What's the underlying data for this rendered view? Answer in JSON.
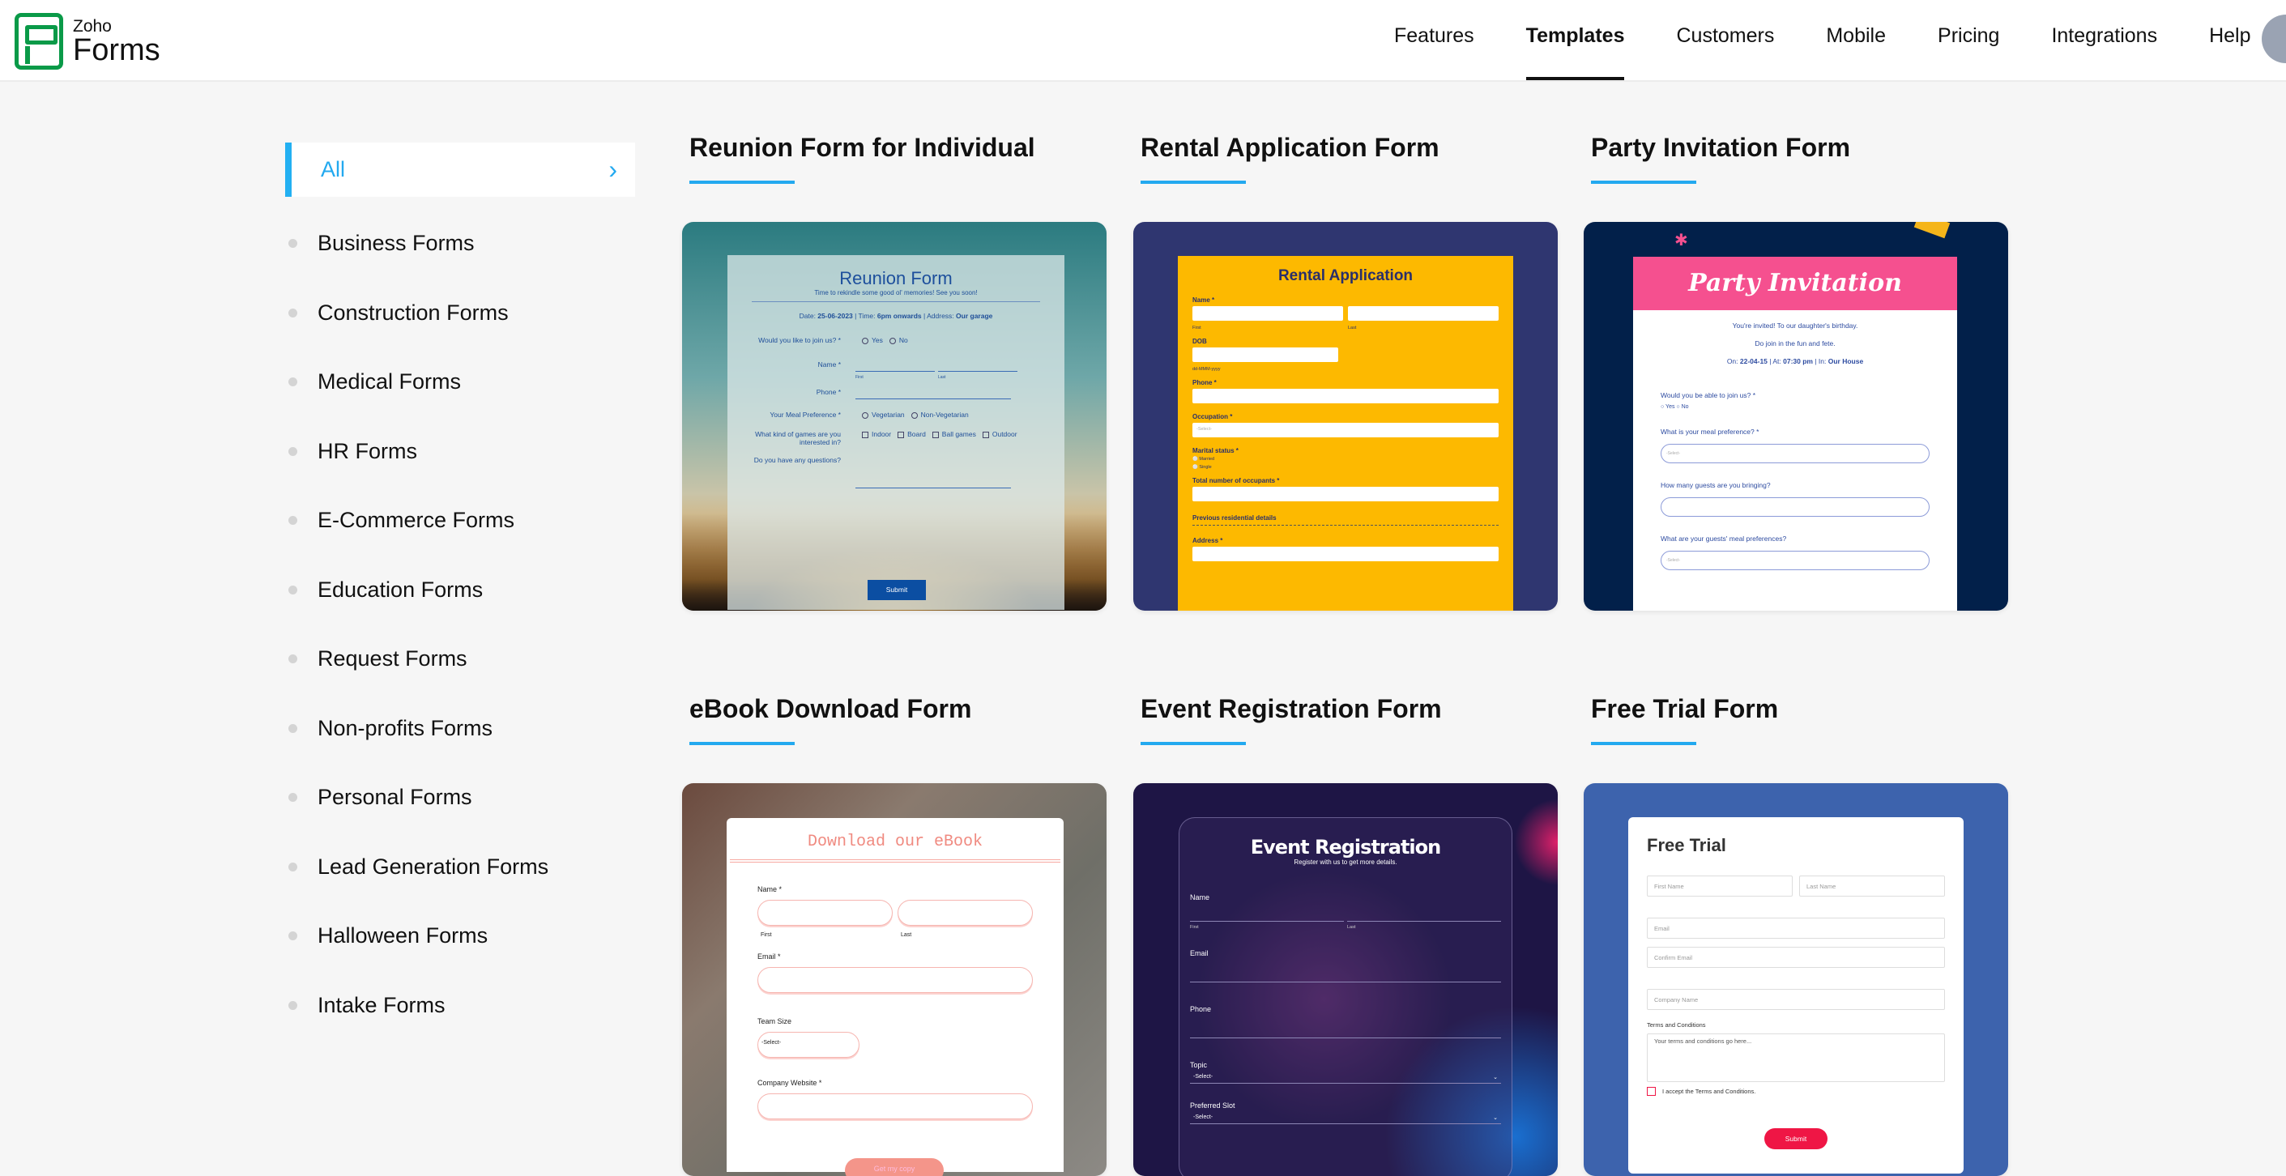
{
  "header": {
    "logo_top": "Zoho",
    "logo_bottom": "Forms",
    "nav": [
      "Features",
      "Templates",
      "Customers",
      "Mobile",
      "Pricing",
      "Integrations",
      "Help"
    ],
    "active": "Templates"
  },
  "sidebar": {
    "selected": "All",
    "items": [
      "Business Forms",
      "Construction Forms",
      "Medical Forms",
      "HR Forms",
      "E-Commerce Forms",
      "Education Forms",
      "Request Forms",
      "Non-profits Forms",
      "Personal Forms",
      "Lead Generation Forms",
      "Halloween Forms",
      "Intake Forms"
    ]
  },
  "colors": {
    "accent": "#23a9ef",
    "brand_green": "#0a9a48"
  },
  "templates": [
    {
      "title": "Reunion Form for Individual",
      "preview": {
        "title": "Reunion Form",
        "subtitle": "Time to rekindle some good ol' memories! See you soon!",
        "date_l": "Date: ",
        "date": "25-06-2023",
        "time_l": " | Time: ",
        "time": "6pm onwards",
        "addr_l": " | Address: ",
        "addr": "Our garage",
        "q1": "Would you like to join us? *",
        "yes": "Yes",
        "no": "No",
        "name": "Name *",
        "first": "First",
        "last": "Last",
        "phone": "Phone *",
        "meal": "Your Meal Preference *",
        "veg": "Vegetarian",
        "nonveg": "Non-Vegetarian",
        "games": "What kind of games are you interested in?",
        "g1": "Indoor",
        "g2": "Board",
        "g3": "Ball games",
        "g4": "Outdoor",
        "questions": "Do you have any questions?",
        "submit": "Submit"
      }
    },
    {
      "title": "Rental Application Form",
      "preview": {
        "title": "Rental Application",
        "name": "Name *",
        "first": "First",
        "last": "Last",
        "dob": "DOB",
        "dob_fmt": "dd-MMM-yyyy",
        "phone": "Phone *",
        "occupation": "Occupation *",
        "select": "-Select-",
        "marital": "Marital status *",
        "married": "Married",
        "single": "Single",
        "occupants": "Total number of occupants *",
        "prev": "Previous residential details",
        "address": "Address *"
      }
    },
    {
      "title": "Party Invitation Form",
      "preview": {
        "title": "Party Invitation",
        "l1": "You're invited! To our daughter's birthday.",
        "l2": "Do join in the fun and fete.",
        "on_l": "On: ",
        "on": "22-04-15",
        "at_l": "  |  At: ",
        "at": "07:30 pm",
        "in_l": "  |  In: ",
        "in": "Our House",
        "q1": "Would you be able to join us? *",
        "yes": "Yes",
        "no": "No",
        "q2": "What is your meal preference? *",
        "select": "-Select-",
        "q3": "How many guests are you bringing?",
        "q4": "What are your guests' meal preferences?"
      }
    },
    {
      "title": "eBook Download Form",
      "preview": {
        "title": "Download our eBook",
        "name": "Name *",
        "first": "First",
        "last": "Last",
        "email": "Email *",
        "team": "Team Size",
        "select": "-Select-",
        "website": "Company Website *",
        "button": "Get my copy"
      }
    },
    {
      "title": "Event Registration Form",
      "preview": {
        "title": "Event Registration",
        "subtitle": "Register with us to get more details.",
        "name": "Name",
        "first": "First",
        "last": "Last",
        "email": "Email",
        "phone": "Phone",
        "topic": "Topic",
        "select": "-Select-",
        "slot": "Preferred Slot"
      }
    },
    {
      "title": "Free Trial Form",
      "preview": {
        "title": "Free Trial",
        "first": "First Name",
        "last": "Last Name",
        "email": "Email",
        "confirm": "Confirm Email",
        "company": "Company Name",
        "terms": "Terms and Conditions",
        "terms_text": "Your terms and conditions go here...",
        "accept": "I accept the Terms and Conditions.",
        "submit": "Submit"
      }
    }
  ]
}
